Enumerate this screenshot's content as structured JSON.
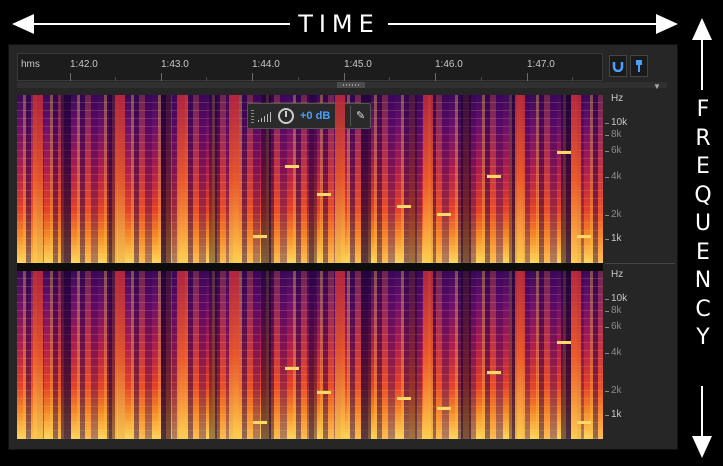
{
  "annotations": {
    "time_label": "TIME",
    "frequency_label": [
      "F",
      "R",
      "E",
      "Q",
      "U",
      "E",
      "N",
      "C",
      "Y"
    ]
  },
  "ruler": {
    "unit_label": "hms",
    "ticks": [
      "1:42.0",
      "1:43.0",
      "1:44.0",
      "1:45.0",
      "1:46.0",
      "1:47.0"
    ]
  },
  "toolbar": {
    "magnet_icon": "magnet-icon",
    "pin_icon": "marker-pin-icon"
  },
  "hud": {
    "gain_label": "+0 dB",
    "level_icon": "level-meter-icon",
    "knob_icon": "gain-knob-icon",
    "pin_icon": "pin-icon"
  },
  "frequency_axis": {
    "unit": "Hz",
    "labels": [
      {
        "text": "10k",
        "strong": true
      },
      {
        "text": "8k",
        "strong": false
      },
      {
        "text": "6k",
        "strong": false
      },
      {
        "text": "4k",
        "strong": false
      },
      {
        "text": "2k",
        "strong": false
      },
      {
        "text": "1k",
        "strong": true
      }
    ]
  },
  "channels": [
    "top",
    "bottom"
  ],
  "colors": {
    "background": "#000000",
    "panel": "#262626",
    "accent": "#4aa0ff",
    "spectrogram_low": "#3a0a5a",
    "spectrogram_high": "#ffd860"
  }
}
